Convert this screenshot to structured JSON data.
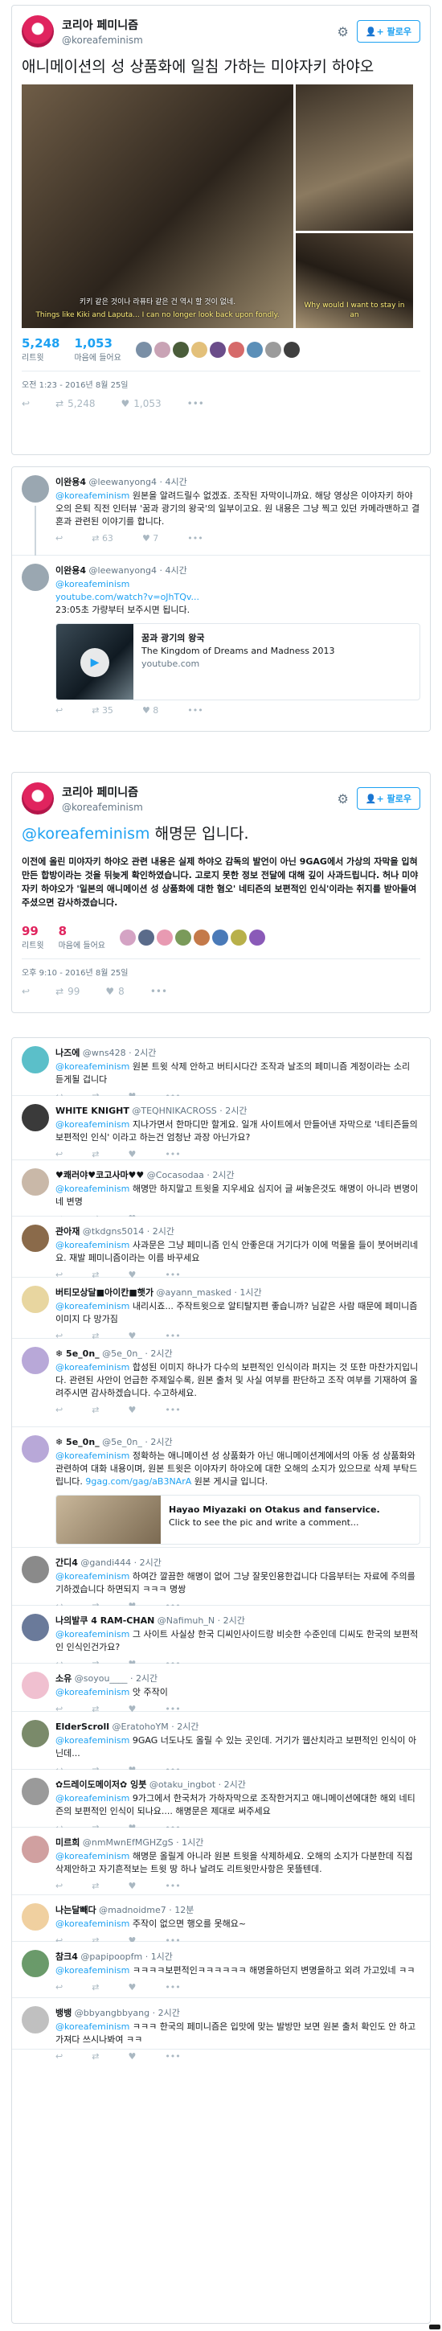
{
  "tweet1": {
    "name": "코리아 페미니즘",
    "handle": "@koreafeminism",
    "follow": "팔로우",
    "text": "애니메이션의 성 상품화에 일침 가하는 미야자키 하야오",
    "sub1": "Things like Kiki and Laputa... I can no longer look back upon fondly.",
    "sub1_top": "키키 같은 것이나 라퓨타 같은 건 역시 할 것이 없네.",
    "sub3": "Why would I want to stay in an",
    "retweets": "5,248",
    "retweets_label": "리트윗",
    "likes": "1,053",
    "likes_label": "마음에 들어요",
    "time": "오전 1:23 - 2016년 8월 25일",
    "act_rt": "5,248",
    "act_like": "1,053"
  },
  "replies_a": [
    {
      "name": "이완용4",
      "handle": "@leewanyong4",
      "time": "4시간",
      "mention": "@koreafeminism",
      "text": " 원본을 알려드릴수 없겠죠. 조작된 자막이니까요. 해당 영상은 이야자키 하야오의 은퇴 직전 인터뷰 '꿈과 광기의 왕국'의 일부이고요. 원 내용은 그냥 찍고 있던 카메라맨하고 결혼과 관련된 이야기를 합니다.",
      "rt": "63",
      "like": "7"
    },
    {
      "name": "이완용4",
      "handle": "@leewanyong4",
      "time": "4시간",
      "mention": "@koreafeminism",
      "link": "youtube.com/watch?v=oJhTQv...",
      "text": "23:05초 가량부터 보주시면 됩니다.",
      "card_title": "꿈과 광기의 왕국",
      "card_desc": "The Kingdom of Dreams and Madness 2013",
      "card_url": "youtube.com",
      "rt": "35",
      "like": "8"
    }
  ],
  "tweet2": {
    "name": "코리아 페미니즘",
    "handle": "@koreafeminism",
    "follow": "팔로우",
    "mention": "@koreafeminism",
    "title": " 해명문 입니다.",
    "body": "이전에 올린 미야자키 하야오 관련 내용은 실제 하야오 감독의 발언이 아닌 9GAG에서 가상의 자막을 입혀 만든 합방이라는 것을 뒤늦게 확인하였습니다. 고로지 못한 정보 전달에 대해 깊이 사과드립니다. 허나 미야자키 하야오가 '일본의 애니메이션 성 상품화에 대한 혐오' 네티즌의 보편적인 인식'이라는 취지를 받아들여 주셨으면 감사하겠습니다.",
    "retweets": "99",
    "retweets_label": "리트윗",
    "likes": "8",
    "likes_label": "마음에 들어요",
    "time": "오후 9:10 - 2016년 8월 25일",
    "act_rt": "99",
    "act_like": "8"
  },
  "replies_b": [
    {
      "name": "나즈에",
      "handle": "@wns428",
      "time": "2시간",
      "mention": "@koreafeminism",
      "text": " 원본 트윗 삭제 안하고 버티시다간 조작과 날조의 페미니즘 계정이라는 소리 듣게될 겁니다"
    },
    {
      "name": "WHITE KNIGHT",
      "handle": "@TEQHNIKACROSS",
      "time": "2시간",
      "mention": "@koreafeminism",
      "text": " 지나가면서 한마디만 할게요. 일개 사이트에서 만들어낸 자막으로 '네티즌들의 보편적인 인식' 이라고 하는건 엄청난 과장 아닌가요?"
    },
    {
      "name": "♥쾌러야♥코고사마♥♥",
      "handle": "@Cocasodaa",
      "time": "2시간",
      "mention": "@koreafeminism",
      "text": " 해명만 하지말고 트윗을 지우세요 심지어 글 써놓은것도 해명이 아니라 변명이네 변명"
    },
    {
      "name": "관아재",
      "handle": "@tkdgns5014",
      "time": "2시간",
      "mention": "@koreafeminism",
      "text": " 사과문은 그냥 페미니즘 인식 안좋은대 거기다가 이에 먹물을 들이 붓어버리네요. 재발 페미니즘이라는 이름 바꾸세요"
    },
    {
      "name": "버티모상달■아이칸■햇가",
      "handle": "@ayann_masked",
      "time": "1시간",
      "mention": "@koreafeminism",
      "text": " 내리시죠... 주작트윗으로 알티탈지편 좋습니까? 님같은 사람 때문에 페미니즘 이미지 다 망가짐"
    },
    {
      "name": "❄ 5e_0n_",
      "handle": "@5e_0n_",
      "time": "2시간",
      "mention": "@koreafeminism",
      "text": " 합성된 이미지 하나가 다수의 보편적인 인식이라 퍼지는 것 또한 마찬가지입니다. 관련된 사안이 언급한 주제일수록, 원본 출처 및 사실 여부를 판단하고 조작 여부를 기재하여 올려주시면 감사하겠습니다. 수고하세요."
    },
    {
      "name": "❄ 5e_0n_",
      "handle": "@5e_0n_",
      "time": "2시간",
      "mention": "@koreafeminism",
      "text": " 정확하는 애니메이션 성 상품화가 아닌 애니메이션계에서의 아동 성 상품화와 관련하여 대화 내용이며, 원본 트윗은 이야자키 하야오에 대한 오해의 소지가 있으므로 삭제 부탁드립니다.",
      "link": "9gag.com/gag/aB3NArA",
      "link_after": " 원본 게시글 입니다.",
      "card_title": "Hayao Miyazaki on Otakus and fanservice.",
      "card_desc": "Click to see the pic and write a comment..."
    },
    {
      "name": "간디4",
      "handle": "@gandi444",
      "time": "2시간",
      "mention": "@koreafeminism",
      "text": " 하여간 깔끔한 해명이 없어 그냥 잘못인용한겁니다 다음부터는 자료에 주의를 기하겠습니다 하면되지 ㅋㅋㅋ 명쌍"
    },
    {
      "name": "나의발쿠 4 RAM-CHAN",
      "handle": "@Nafimuh_N",
      "time": "2시간",
      "mention": "@koreafeminism",
      "text": " 그 사이트 사실상 한국 디씨인사이드랑 비슷한 수준인데 디씨도 한국의 보편적인 인식인건가요?"
    },
    {
      "name": "소유",
      "handle": "@soyou____",
      "time": "2시간",
      "mention": "@koreafeminism",
      "text": " 앗 주작이"
    },
    {
      "name": "ElderScroll",
      "handle": "@EratohoYM",
      "time": "2시간",
      "mention": "@koreafeminism",
      "text": " 9GAG 너도나도 올릴 수 있는 곳인데. 거기가 웹산치라고 보편적인 인식이 아닌데..."
    },
    {
      "name": "✿드레이도메이저✿ 잉붓",
      "handle": "@otaku_ingbot",
      "time": "2시간",
      "mention": "@koreafeminism",
      "text": " 9가그에서 한국처가 가하자막으로 조작한거지고 애니메이션에대한 해외 네티즌의 보편적인 인식이 되나요.... 해명문은 제대로 써주세요"
    },
    {
      "name": "미르희",
      "handle": "@nmMwnEfMGHZgS",
      "time": "1시간",
      "mention": "@koreafeminism",
      "text": " 해명문 올릴게 아니라 원본 트윗을 삭제하세요. 오해의 소지가 다분한데 직접 삭제안하고 자기흔적보는 트윗 땅 하나 날려도 리트윗만사항은 못뜰텐데."
    },
    {
      "name": "나는달빼다",
      "handle": "@madnoidme7",
      "time": "12분",
      "mention": "@koreafeminism",
      "text": " 주작이 없으면 행오를 못해요~"
    },
    {
      "name": "참크4",
      "handle": "@papipoopfm",
      "time": "1시간",
      "mention": "@koreafeminism",
      "text": " ㅋㅋㅋㅋ보편적인ㅋㅋㅋㅋㅋㅋ 해명을하던지 변명을하고 외려 가고있네 ㅋㅋ"
    },
    {
      "name": "뱅뱅",
      "handle": "@bbyangbbyang",
      "time": "2시간",
      "mention": "@koreafeminism",
      "text": " ㅋㅋㅋ 한국의 페미니즘은 입맛에 맞는 발방만 보면 원본 출처 확인도 안 하고 가져다 쓰시나봐여 ㅋㅋ"
    }
  ],
  "colors": {
    "brand": "#e0245e",
    "link": "#1da1f2",
    "muted": "#657786"
  }
}
